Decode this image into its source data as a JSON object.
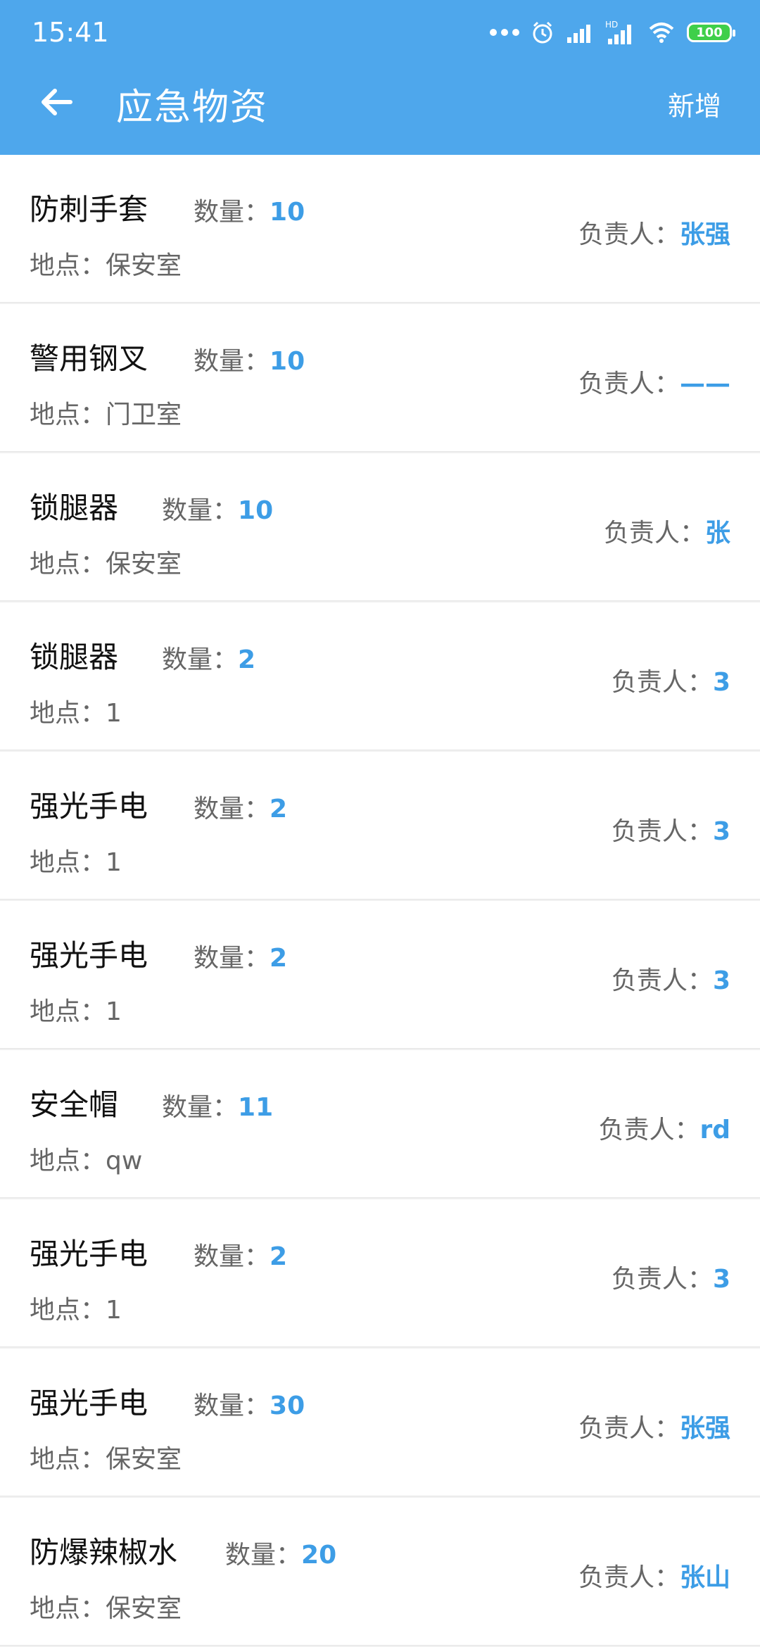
{
  "status": {
    "time": "15:41",
    "battery": "100",
    "network": "HD"
  },
  "header": {
    "title": "应急物资",
    "action": "新增"
  },
  "labels": {
    "qty": "数量：",
    "owner": "负责人：",
    "loc": "地点："
  },
  "items": [
    {
      "name": "防刺手套",
      "qty": "10",
      "loc": "保安室",
      "owner": "张强"
    },
    {
      "name": "警用钢叉",
      "qty": "10",
      "loc": "门卫室",
      "owner": "——"
    },
    {
      "name": "锁腿器",
      "qty": "10",
      "loc": "保安室",
      "owner": "张"
    },
    {
      "name": "锁腿器",
      "qty": "2",
      "loc": "1",
      "owner": "3"
    },
    {
      "name": "强光手电",
      "qty": "2",
      "loc": "1",
      "owner": "3"
    },
    {
      "name": "强光手电",
      "qty": "2",
      "loc": "1",
      "owner": "3"
    },
    {
      "name": "安全帽",
      "qty": "11",
      "loc": "qw",
      "owner": "rd"
    },
    {
      "name": "强光手电",
      "qty": "2",
      "loc": "1",
      "owner": "3"
    },
    {
      "name": "强光手电",
      "qty": "30",
      "loc": "保安室",
      "owner": "张强"
    },
    {
      "name": "防爆辣椒水",
      "qty": "20",
      "loc": "保安室",
      "owner": "张山"
    }
  ],
  "colors": {
    "primary": "#4ea7ec",
    "accent": "#3d9de6"
  }
}
